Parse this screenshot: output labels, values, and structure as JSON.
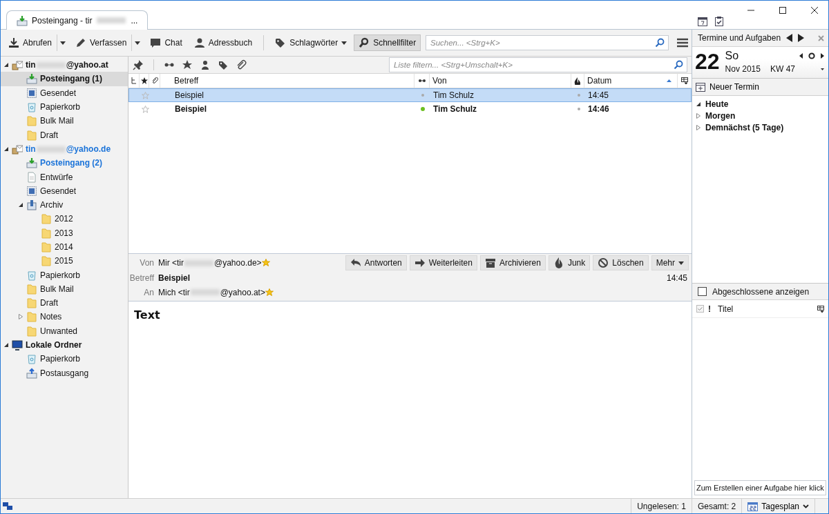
{
  "window": {
    "tab": {
      "title_prefix": "Posteingang - tir",
      "title_suffix": "...",
      "selected": true
    }
  },
  "toolbar": {
    "buttons": [
      {
        "label": "Abrufen",
        "kind": "split",
        "selected": false
      },
      {
        "label": "Verfassen",
        "kind": "split",
        "selected": false
      },
      {
        "label": "Chat",
        "kind": "plain",
        "selected": false
      },
      {
        "label": "Adressbuch",
        "kind": "plain",
        "selected": false
      },
      {
        "label": "Schlagwörter",
        "kind": "menu",
        "selected": false
      },
      {
        "label": "Schnellfilter",
        "kind": "plain",
        "selected": true
      }
    ],
    "search": {
      "placeholder": "Suchen... <Strg+K>"
    }
  },
  "folders": [
    {
      "prefix": "tin",
      "suffix": "@yahoo.at",
      "kind": "account",
      "expanded": true,
      "selected": false,
      "unread": true,
      "new": false,
      "children": [
        {
          "label": "Posteingang (1)",
          "kind": "inbox",
          "selected": true,
          "unread": true,
          "new": false
        },
        {
          "label": "Gesendet",
          "kind": "sent",
          "selected": false,
          "unread": false,
          "new": false
        },
        {
          "label": "Papierkorb",
          "kind": "trash",
          "selected": false,
          "unread": false,
          "new": false
        },
        {
          "label": "Bulk Mail",
          "kind": "folder",
          "selected": false,
          "unread": false,
          "new": false
        },
        {
          "label": "Draft",
          "kind": "folder",
          "selected": false,
          "unread": false,
          "new": false
        }
      ]
    },
    {
      "prefix": "tin",
      "suffix": "@yahoo.de",
      "kind": "account",
      "expanded": true,
      "selected": false,
      "unread": true,
      "new": true,
      "children": [
        {
          "label": "Posteingang (2)",
          "kind": "inbox",
          "selected": false,
          "unread": true,
          "new": true
        },
        {
          "label": "Entwürfe",
          "kind": "drafts",
          "selected": false,
          "unread": false,
          "new": false
        },
        {
          "label": "Gesendet",
          "kind": "sent",
          "selected": false,
          "unread": false,
          "new": false
        },
        {
          "label": "Archiv",
          "kind": "archive",
          "expanded": true,
          "selected": false,
          "unread": false,
          "new": false,
          "children": [
            {
              "label": "2012",
              "kind": "folder",
              "selected": false,
              "unread": false,
              "new": false
            },
            {
              "label": "2013",
              "kind": "folder",
              "selected": false,
              "unread": false,
              "new": false
            },
            {
              "label": "2014",
              "kind": "folder",
              "selected": false,
              "unread": false,
              "new": false
            },
            {
              "label": "2015",
              "kind": "folder",
              "selected": false,
              "unread": false,
              "new": false
            }
          ]
        },
        {
          "label": "Papierkorb",
          "kind": "trash",
          "selected": false,
          "unread": false,
          "new": false
        },
        {
          "label": "Bulk Mail",
          "kind": "folder",
          "selected": false,
          "unread": false,
          "new": false
        },
        {
          "label": "Draft",
          "kind": "folder",
          "selected": false,
          "unread": false,
          "new": false
        },
        {
          "label": "Notes",
          "kind": "folder",
          "expanded": false,
          "selected": false,
          "unread": false,
          "new": false
        },
        {
          "label": "Unwanted",
          "kind": "folder",
          "selected": false,
          "unread": false,
          "new": false
        }
      ]
    },
    {
      "label": "Lokale Ordner",
      "kind": "local",
      "expanded": true,
      "selected": false,
      "unread": true,
      "new": false,
      "children": [
        {
          "label": "Papierkorb",
          "kind": "trash",
          "selected": false,
          "unread": false,
          "new": false
        },
        {
          "label": "Postausgang",
          "kind": "outbox",
          "selected": false,
          "unread": false,
          "new": false
        }
      ]
    }
  ],
  "quick_filter": {
    "placeholder": "Liste filtern... <Strg+Umschalt+K>"
  },
  "message_list": {
    "columns": [
      "Betreff",
      "Von",
      "Datum"
    ],
    "rows": [
      {
        "subject": "Beispiel",
        "from": "Tim Schulz",
        "date": "14:45",
        "selected": true,
        "unread": false,
        "starred": false
      },
      {
        "subject": "Beispiel",
        "from": "Tim Schulz",
        "date": "14:46",
        "selected": false,
        "unread": true,
        "starred": false
      }
    ]
  },
  "message_header": {
    "fields": [
      {
        "label": "Von",
        "prefix": "Mir <tir",
        "suffix": "@yahoo.de>",
        "kind": "address"
      },
      {
        "label": "Betreff",
        "value": "Beispiel",
        "kind": "subject",
        "date": "14:45"
      },
      {
        "label": "An",
        "prefix": "Mich <tir",
        "suffix": "@yahoo.at>",
        "kind": "address"
      }
    ],
    "buttons": [
      {
        "label": "Antworten",
        "kind": "reply"
      },
      {
        "label": "Weiterleiten",
        "kind": "forward"
      },
      {
        "label": "Archivieren",
        "kind": "archive"
      },
      {
        "label": "Junk",
        "kind": "junk"
      },
      {
        "label": "Löschen",
        "kind": "delete"
      },
      {
        "label": "Mehr",
        "kind": "more"
      }
    ]
  },
  "message_body": "Text",
  "today_pane": {
    "title": "Termine und Aufgaben",
    "day": "22",
    "weekday": "So",
    "month": "Nov 2015",
    "week": "KW 47",
    "new_event": "Neuer Termin",
    "agenda": [
      {
        "label": "Heute",
        "expanded": true
      },
      {
        "label": "Morgen",
        "expanded": false
      },
      {
        "label": "Demnächst (5 Tage)",
        "expanded": false
      }
    ],
    "show_completed": {
      "label": "Abgeschlossene anzeigen",
      "checked": false
    },
    "task_columns": {
      "priority": "!",
      "title": "Titel"
    },
    "new_task": {
      "placeholder": "Zum Erstellen einer Aufgabe hier klick"
    }
  },
  "status_bar": {
    "unread": "Ungelesen: 1",
    "total": "Gesamt: 2",
    "mode": "Tagesplan"
  }
}
